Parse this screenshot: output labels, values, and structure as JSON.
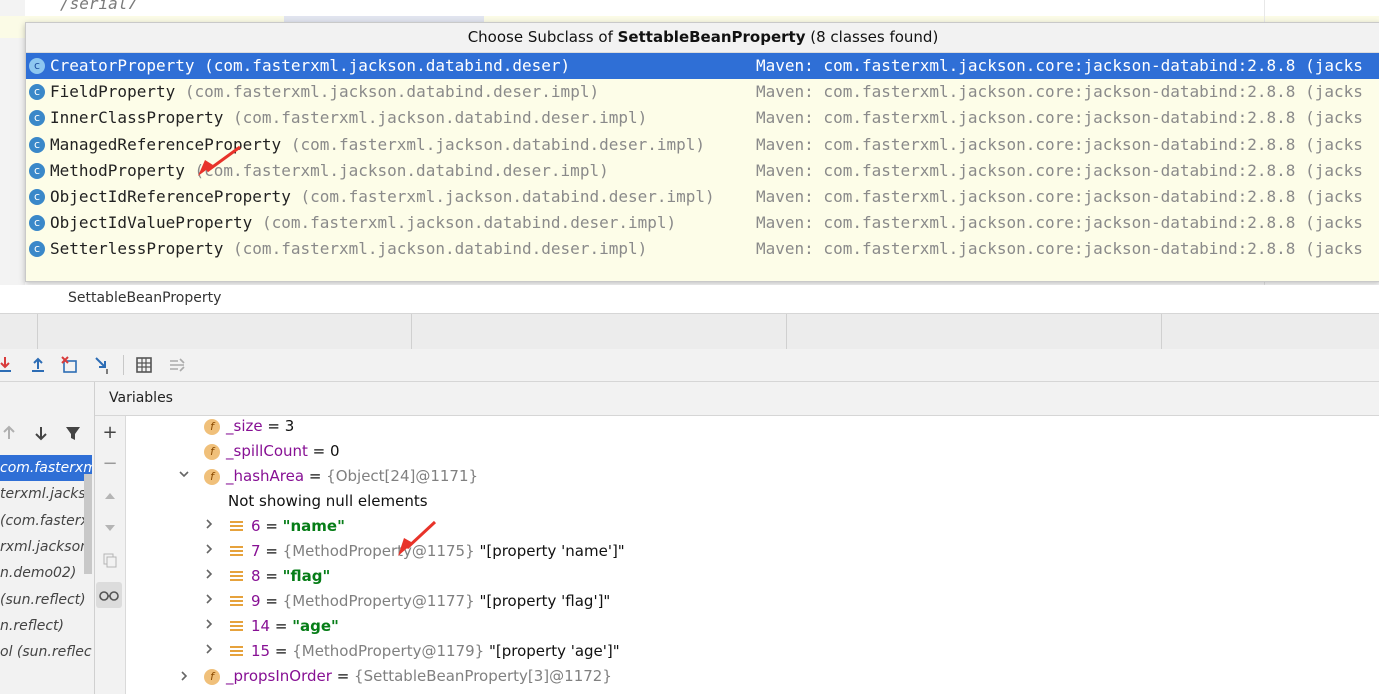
{
  "editor": {
    "line1": "/serial7"
  },
  "popup": {
    "title_prefix": "Choose Subclass of ",
    "title_class": "SettableBeanProperty",
    "title_suffix": " (8 classes found)",
    "items": [
      {
        "name": "CreatorProperty",
        "pkg": "(com.fasterxml.jackson.databind.deser)",
        "maven": "Maven: com.fasterxml.jackson.core:jackson-databind:2.8.8 (jacks",
        "selected": true
      },
      {
        "name": "FieldProperty",
        "pkg": "(com.fasterxml.jackson.databind.deser.impl)",
        "maven": "Maven: com.fasterxml.jackson.core:jackson-databind:2.8.8 (jacks",
        "selected": false
      },
      {
        "name": "InnerClassProperty",
        "pkg": "(com.fasterxml.jackson.databind.deser.impl)",
        "maven": "Maven: com.fasterxml.jackson.core:jackson-databind:2.8.8 (jacks",
        "selected": false
      },
      {
        "name": "ManagedReferenceProperty",
        "pkg": "(com.fasterxml.jackson.databind.deser.impl)",
        "maven": "Maven: com.fasterxml.jackson.core:jackson-databind:2.8.8 (jacks",
        "selected": false
      },
      {
        "name": "MethodProperty",
        "pkg": "(com.fasterxml.jackson.databind.deser.impl)",
        "maven": "Maven: com.fasterxml.jackson.core:jackson-databind:2.8.8 (jacks",
        "selected": false
      },
      {
        "name": "ObjectIdReferenceProperty",
        "pkg": "(com.fasterxml.jackson.databind.deser.impl)",
        "maven": "Maven: com.fasterxml.jackson.core:jackson-databind:2.8.8 (jacks",
        "selected": false
      },
      {
        "name": "ObjectIdValueProperty",
        "pkg": "(com.fasterxml.jackson.databind.deser.impl)",
        "maven": "Maven: com.fasterxml.jackson.core:jackson-databind:2.8.8 (jacks",
        "selected": false
      },
      {
        "name": "SetterlessProperty",
        "pkg": "(com.fasterxml.jackson.databind.deser.impl)",
        "maven": "Maven: com.fasterxml.jackson.core:jackson-databind:2.8.8 (jacks",
        "selected": false
      }
    ]
  },
  "breadcrumb": "SettableBeanProperty",
  "variables_title": "Variables",
  "frames": [
    {
      "text": "com.fasterxml.j",
      "selected": true
    },
    {
      "text": "terxml.jackso",
      "selected": false
    },
    {
      "text": "(com.fasterxm",
      "selected": false
    },
    {
      "text": "rxml.jackson.c",
      "selected": false
    },
    {
      "text": "n.demo02)",
      "selected": false
    },
    {
      "text": "(sun.reflect)",
      "selected": false
    },
    {
      "text": "n.reflect)",
      "selected": false
    },
    {
      "text": "ol (sun.reflect)",
      "selected": false
    }
  ],
  "variables": {
    "size": {
      "name": "_size",
      "eq": " = ",
      "value": "3"
    },
    "spill": {
      "name": "_spillCount",
      "eq": " = ",
      "value": "0"
    },
    "hash": {
      "name": "_hashArea",
      "eq": " = ",
      "value": "{Object[24]@1171}"
    },
    "note": "Not showing null elements",
    "entries": [
      {
        "idx": "6",
        "eq": " = ",
        "ref": "",
        "str": "\"name\""
      },
      {
        "idx": "7",
        "eq": " = ",
        "ref": "{MethodProperty@1175}",
        "str": "\"[property 'name']\""
      },
      {
        "idx": "8",
        "eq": " = ",
        "ref": "",
        "str": "\"flag\""
      },
      {
        "idx": "9",
        "eq": " = ",
        "ref": "{MethodProperty@1177}",
        "str": "\"[property 'flag']\""
      },
      {
        "idx": "14",
        "eq": " = ",
        "ref": "",
        "str": "\"age\""
      },
      {
        "idx": "15",
        "eq": " = ",
        "ref": "{MethodProperty@1179}",
        "str": "\"[property 'age']\""
      }
    ],
    "props": {
      "name": "_propsInOrder",
      "eq": " = ",
      "value": "{SettableBeanProperty[3]@1172}"
    }
  },
  "colors": {
    "selection": "#2f6fd6",
    "arrow": "#e8332a",
    "popup_bg": "#fdfde8"
  }
}
